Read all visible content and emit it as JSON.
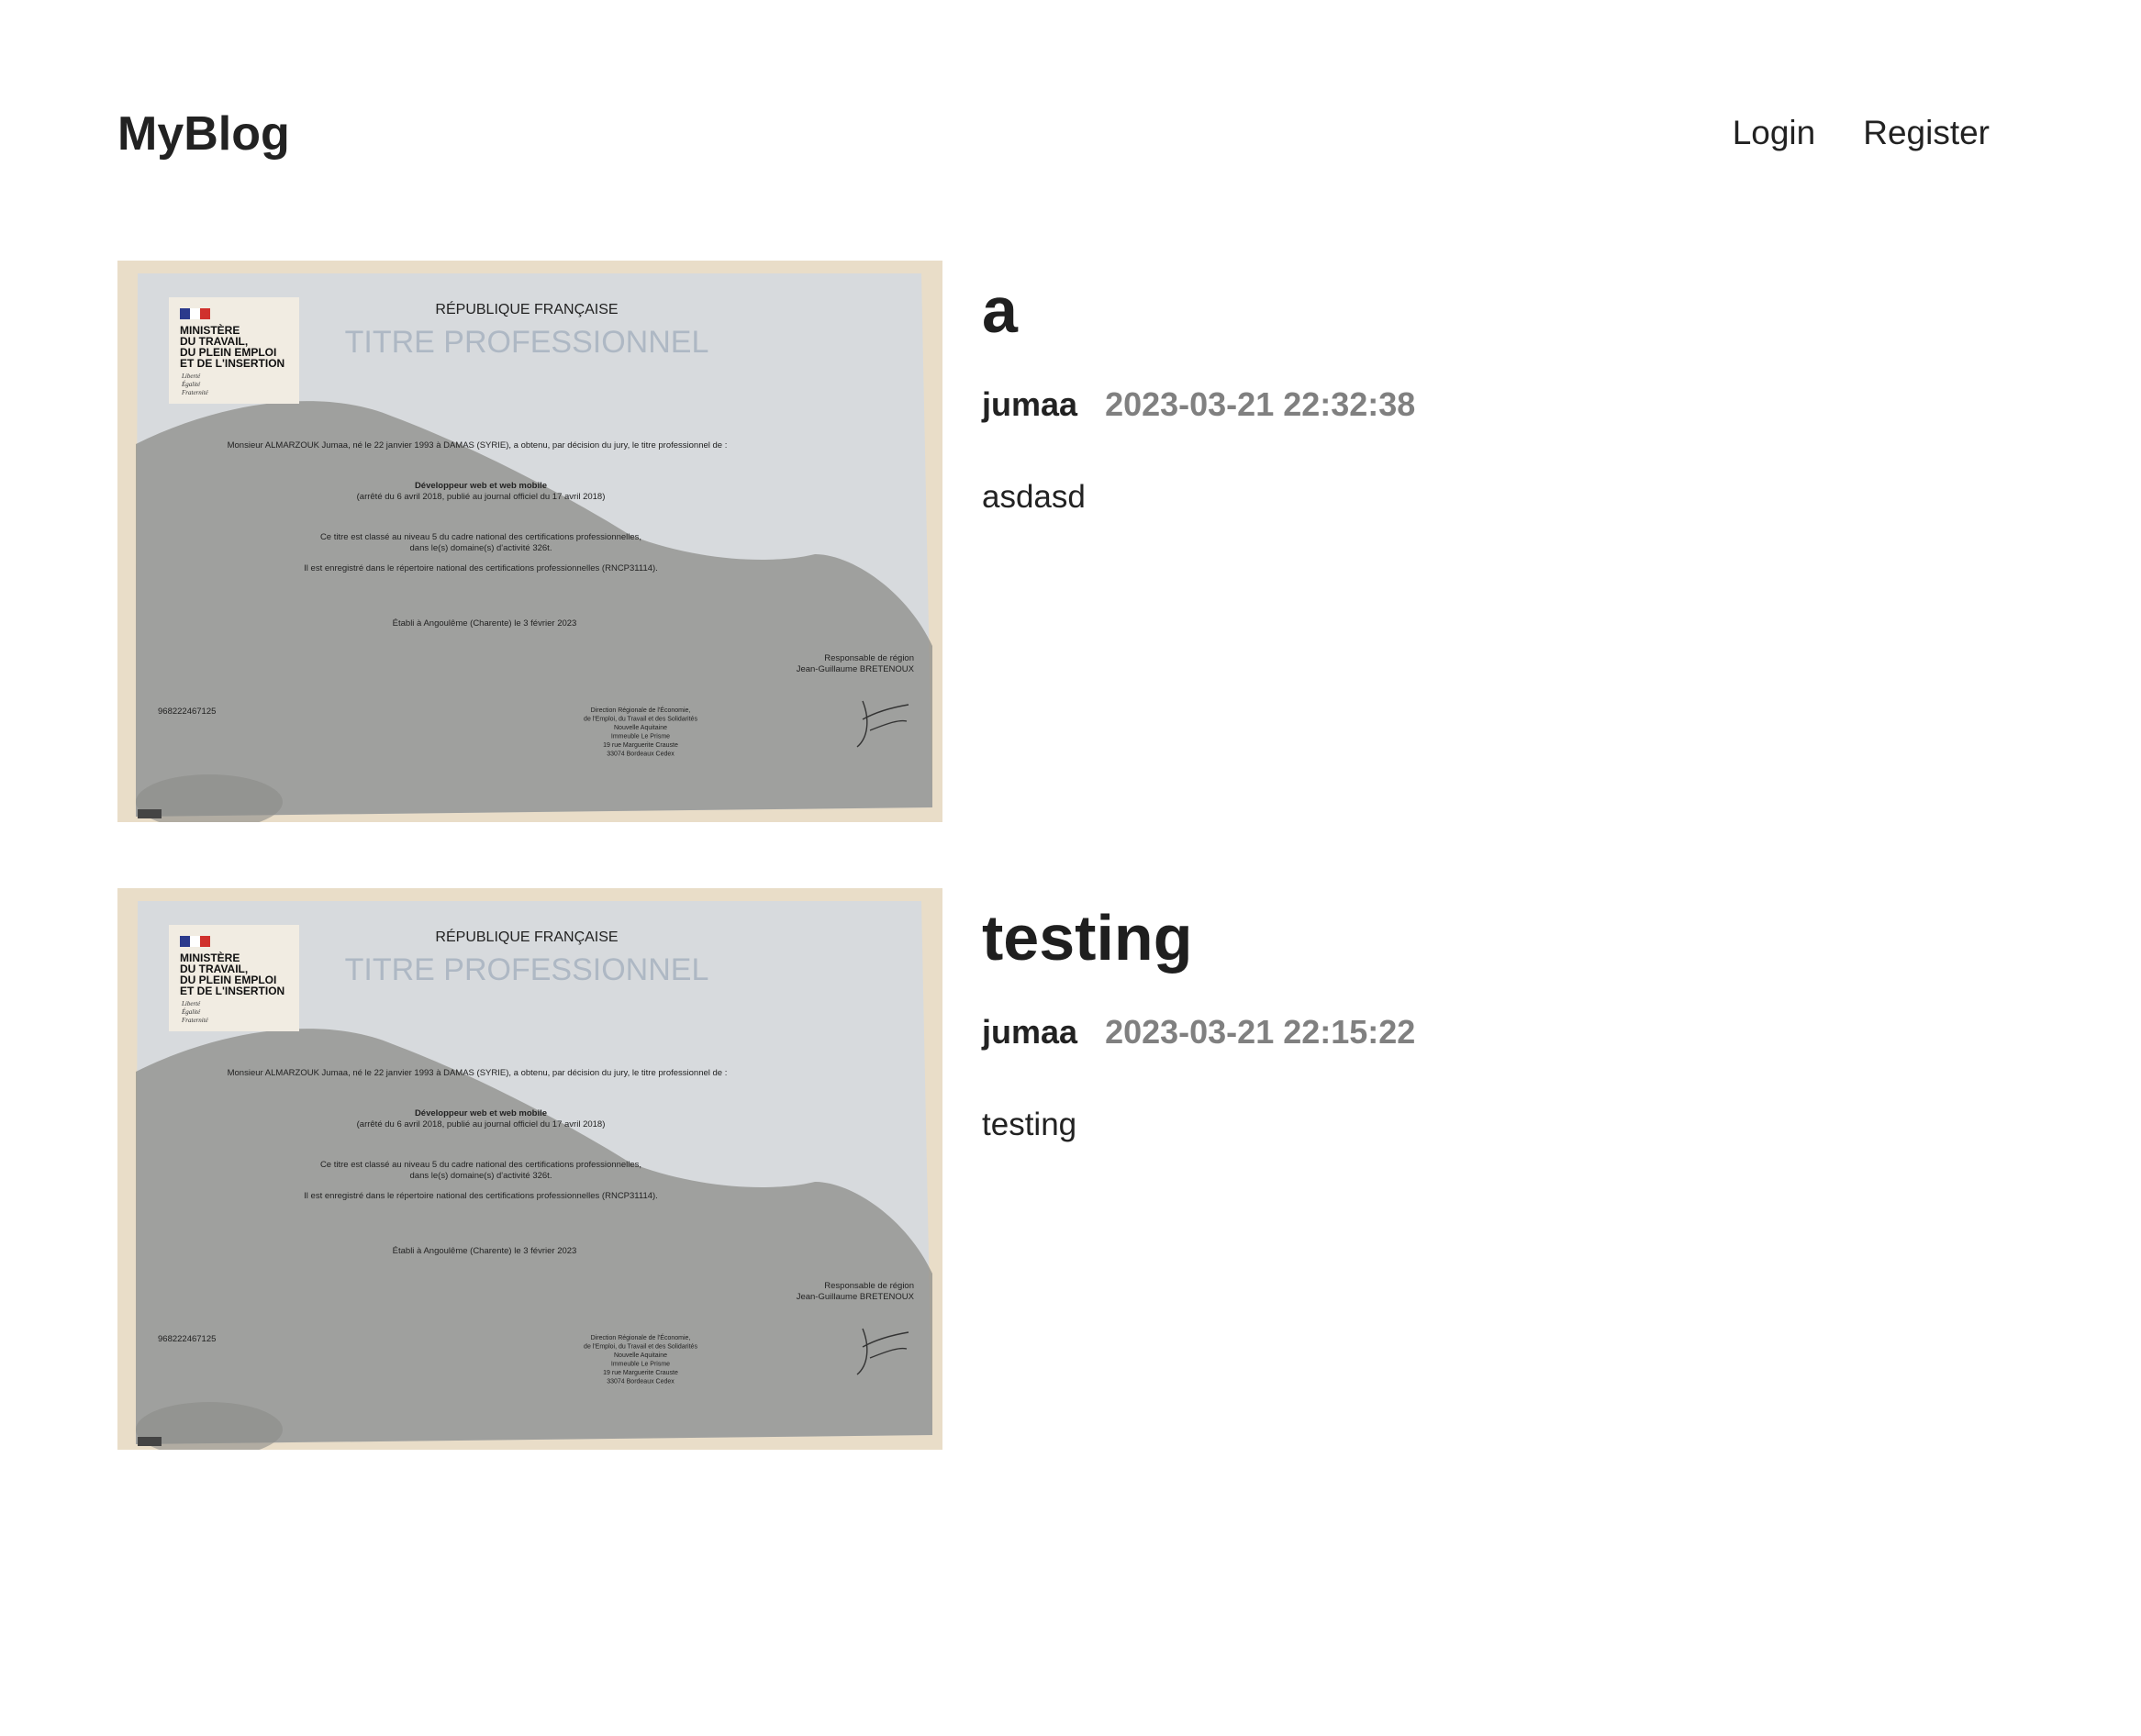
{
  "header": {
    "brand": "MyBlog",
    "nav": [
      {
        "label": "Login"
      },
      {
        "label": "Register"
      }
    ]
  },
  "posts": [
    {
      "title": "a",
      "author": "jumaa",
      "date": "2023-03-21 22:32:38",
      "excerpt": "asdasd"
    },
    {
      "title": "testing",
      "author": "jumaa",
      "date": "2023-03-21 22:15:22",
      "excerpt": "testing"
    }
  ],
  "certificate": {
    "ministry_lines": [
      "MINISTÈRE",
      "DU TRAVAIL,",
      "DU PLEIN EMPLOI",
      "ET DE L'INSERTION"
    ],
    "motto": [
      "Liberté",
      "Égalité",
      "Fraternité"
    ],
    "republic": "RÉPUBLIQUE FRANÇAISE",
    "heading": "TITRE PROFESSIONNEL",
    "line1": "Monsieur ALMARZOUK Jumaa, né le 22 janvier 1993 à DAMAS (SYRIE), a obtenu, par décision du jury, le titre professionnel de :",
    "title_name": "Développeur web et web mobile",
    "title_decree": "(arrêté du 6 avril 2018, publié au journal officiel du 17 avril 2018)",
    "level_a": "Ce titre est classé au niveau 5 du cadre national des certifications professionnelles,",
    "level_b": "dans le(s) domaine(s) d'activité 326t.",
    "rncp": "Il est enregistré dans le répertoire national des certifications professionnelles (RNCP31114).",
    "place": "Établi à Angoulême (Charente) le 3 février 2023",
    "resp_a": "Responsable de région",
    "resp_b": "Jean-Guillaume BRETENOUX",
    "number": "968222467125",
    "address": [
      "Direction Régionale de l'Économie,",
      "de l'Emploi, du Travail et des Solidarités",
      "Nouvelle Aquitaine",
      "Immeuble Le Prisme",
      "19 rue Marguerite Crauste",
      "33074 Bordeaux Cedex"
    ],
    "colors": {
      "paper": "#d7dadd",
      "shadow": "#8c8c88",
      "beige": "#e9ddc8",
      "flag_blue": "#2b3a8c",
      "flag_red": "#d0312d",
      "heading": "#aeb8c4"
    }
  }
}
